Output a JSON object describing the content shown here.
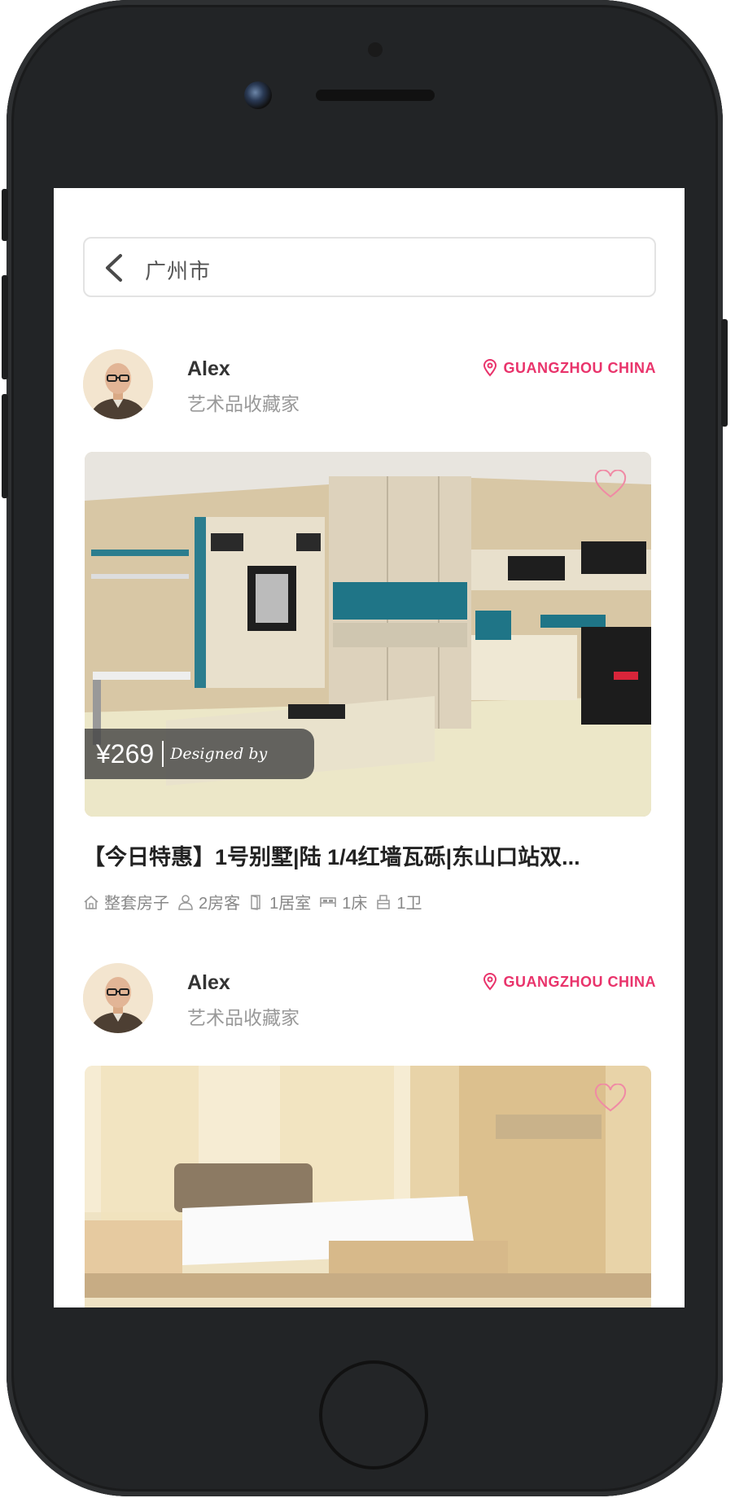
{
  "search": {
    "city": "广州市"
  },
  "listings": [
    {
      "user": {
        "name": "Alex",
        "title": "艺术品收藏家"
      },
      "location": "GUANGZHOU CHINA",
      "price": "¥269",
      "designed_by": "Designed by",
      "title": "【今日特惠】1号别墅|陆 1/4红墙瓦砾|东山口站双...",
      "attributes": {
        "type": "整套房子",
        "guests": "2房客",
        "bedrooms": "1居室",
        "beds": "1床",
        "baths": "1卫"
      }
    },
    {
      "user": {
        "name": "Alex",
        "title": "艺术品收藏家"
      },
      "location": "GUANGZHOU CHINA"
    }
  ],
  "colors": {
    "accent": "#e9336b",
    "phone_body": "#222426"
  }
}
